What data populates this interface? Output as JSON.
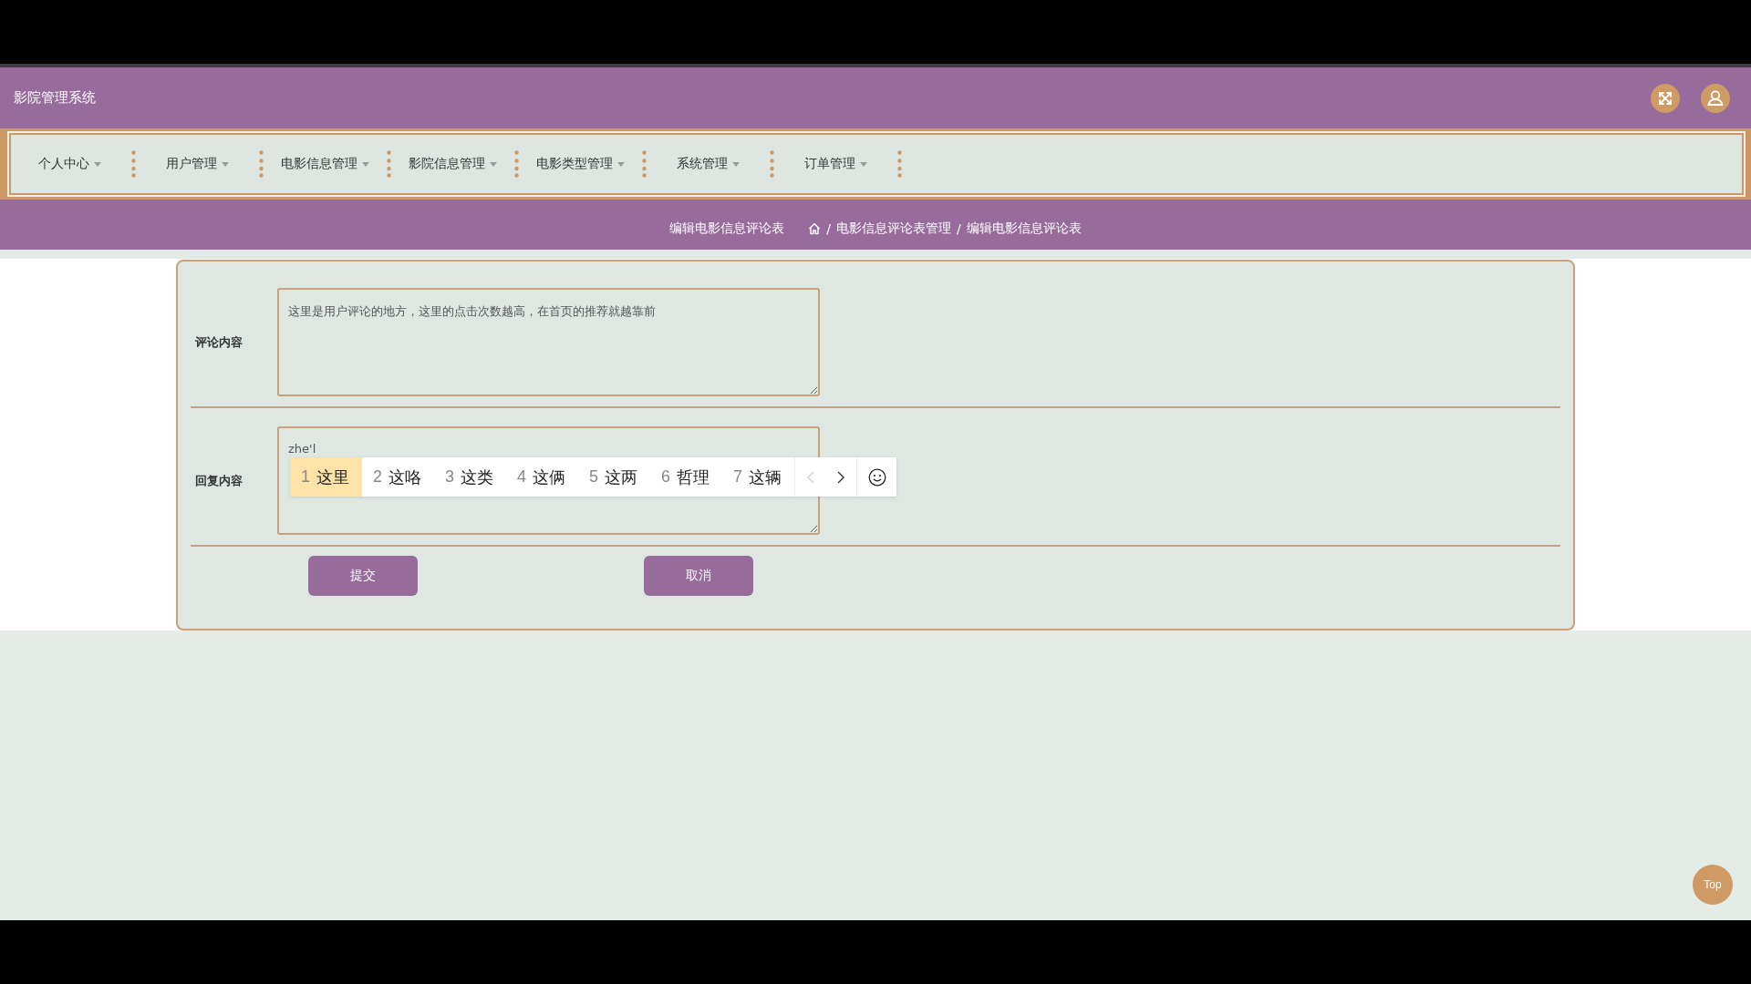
{
  "header": {
    "title": "影院管理系统"
  },
  "nav": {
    "items": [
      {
        "label": "个人中心"
      },
      {
        "label": "用户管理"
      },
      {
        "label": "电影信息管理"
      },
      {
        "label": "影院信息管理"
      },
      {
        "label": "电影类型管理"
      },
      {
        "label": "系统管理"
      },
      {
        "label": "订单管理"
      }
    ]
  },
  "breadcrumb": {
    "page_title": "编辑电影信息评论表",
    "separator": "/",
    "trail": [
      "电影信息评论表管理",
      "编辑电影信息评论表"
    ]
  },
  "form": {
    "fields": [
      {
        "label": "评论内容",
        "value": "这里是用户评论的地方，这里的点击次数越高，在首页的推荐就越靠前"
      },
      {
        "label": "回复内容",
        "value": "zhe'l",
        "ime": {
          "candidates": [
            {
              "number": "1",
              "text": "这里",
              "selected": true
            },
            {
              "number": "2",
              "text": "这咯",
              "selected": false
            },
            {
              "number": "3",
              "text": "这类",
              "selected": false
            },
            {
              "number": "4",
              "text": "这俩",
              "selected": false
            },
            {
              "number": "5",
              "text": "这两",
              "selected": false
            },
            {
              "number": "6",
              "text": "哲理",
              "selected": false
            },
            {
              "number": "7",
              "text": "这辆",
              "selected": false
            }
          ],
          "prev_page": {
            "disabled": true
          },
          "next_page": {
            "disabled": false
          }
        }
      }
    ],
    "buttons": [
      "提交",
      "取消"
    ]
  },
  "back_to_top": {
    "label": "Top"
  }
}
